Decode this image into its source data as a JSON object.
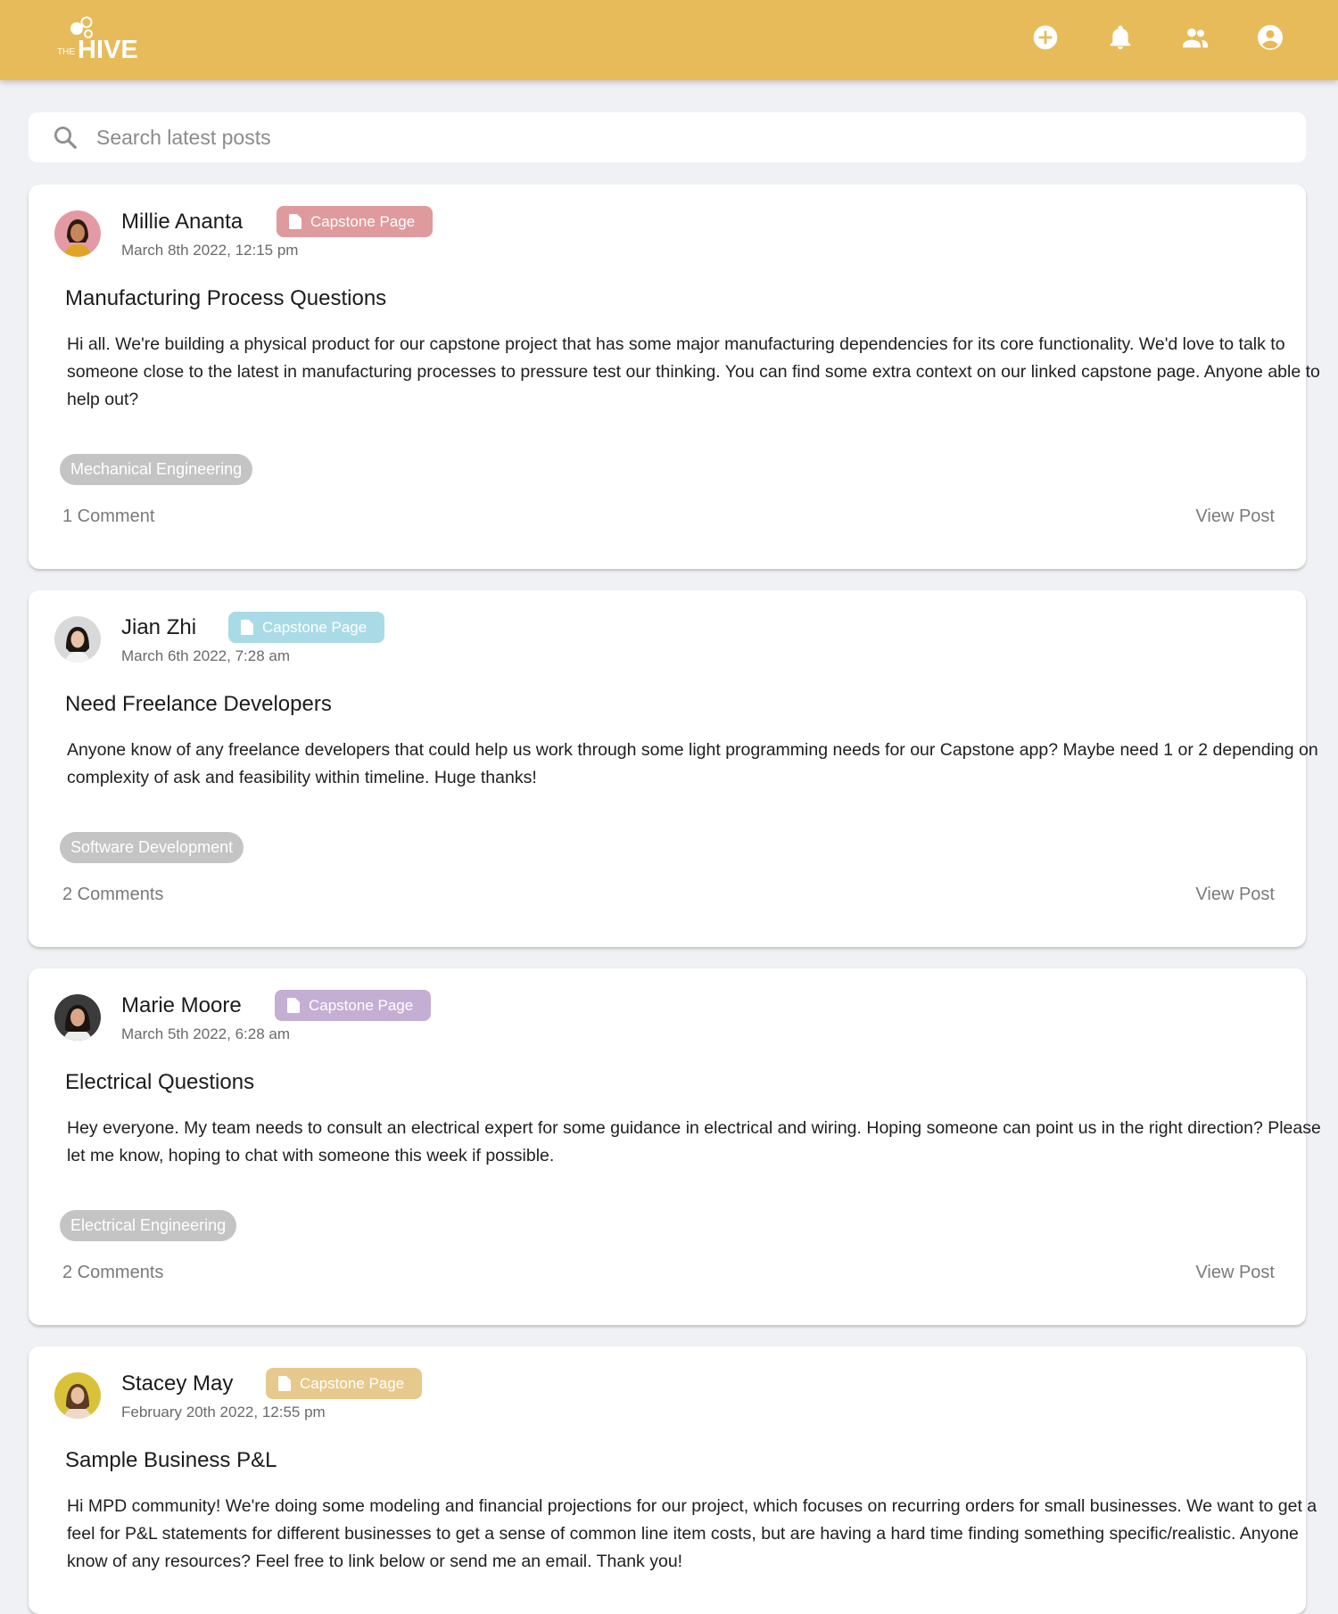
{
  "header": {
    "logo_text_small": "THE",
    "logo_text_large": "HIVE",
    "brand_color": "#e8bb5a",
    "icons": [
      "add-circle-icon",
      "bell-icon",
      "people-icon",
      "account-circle-icon"
    ]
  },
  "search": {
    "placeholder": "Search latest posts",
    "value": ""
  },
  "posts": [
    {
      "author": "Millie Ananta",
      "date": "March 8th 2022, 12:15 pm",
      "badge": "Capstone Page",
      "badge_color": "#de9a9d",
      "title": "Manufacturing Process Questions",
      "body": "Hi all. We're building a physical product for our capstone project that has some major manufacturing dependencies for its core functionality. We'd love to talk to someone close to the latest in manufacturing processes to pressure test our thinking. You can find some extra context on our linked capstone page. Anyone able to help out?",
      "tag": "Mechanical Engineering",
      "comments": "1 Comment",
      "view": "View Post"
    },
    {
      "author": "Jian Zhi",
      "date": "March 6th 2022, 7:28 am",
      "badge": "Capstone Page",
      "badge_color": "#a9dbe7",
      "title": "Need Freelance Developers",
      "body": "Anyone know of any freelance developers that could help us work through some light programming needs for our Capstone app? Maybe need 1 or 2 depending on complexity of ask and feasibility within timeline. Huge thanks!",
      "tag": "Software Development",
      "comments": "2 Comments",
      "view": "View Post"
    },
    {
      "author": "Marie Moore",
      "date": "March 5th 2022, 6:28 am",
      "badge": "Capstone Page",
      "badge_color": "#c5aed3",
      "title": "Electrical Questions",
      "body": "Hey everyone. My team needs to consult an electrical expert for some guidance in electrical and wiring. Hoping someone can point us in the right direction? Please let me know, hoping to chat with someone this week if possible.",
      "tag": "Electrical Engineering",
      "comments": "2 Comments",
      "view": "View Post"
    },
    {
      "author": "Stacey May",
      "date": "February 20th 2022, 12:55 pm",
      "badge": "Capstone Page",
      "badge_color": "#e6c98c",
      "title": "Sample Business P&L",
      "body": "Hi MPD community! We're doing some modeling and financial projections for our project, which focuses on recurring orders for small businesses. We want to get a feel for P&L statements for different businesses to get a sense of common line item costs, but are having a hard time finding something specific/realistic. Anyone know of any resources? Feel free to link below or send me an email. Thank you!"
    }
  ]
}
